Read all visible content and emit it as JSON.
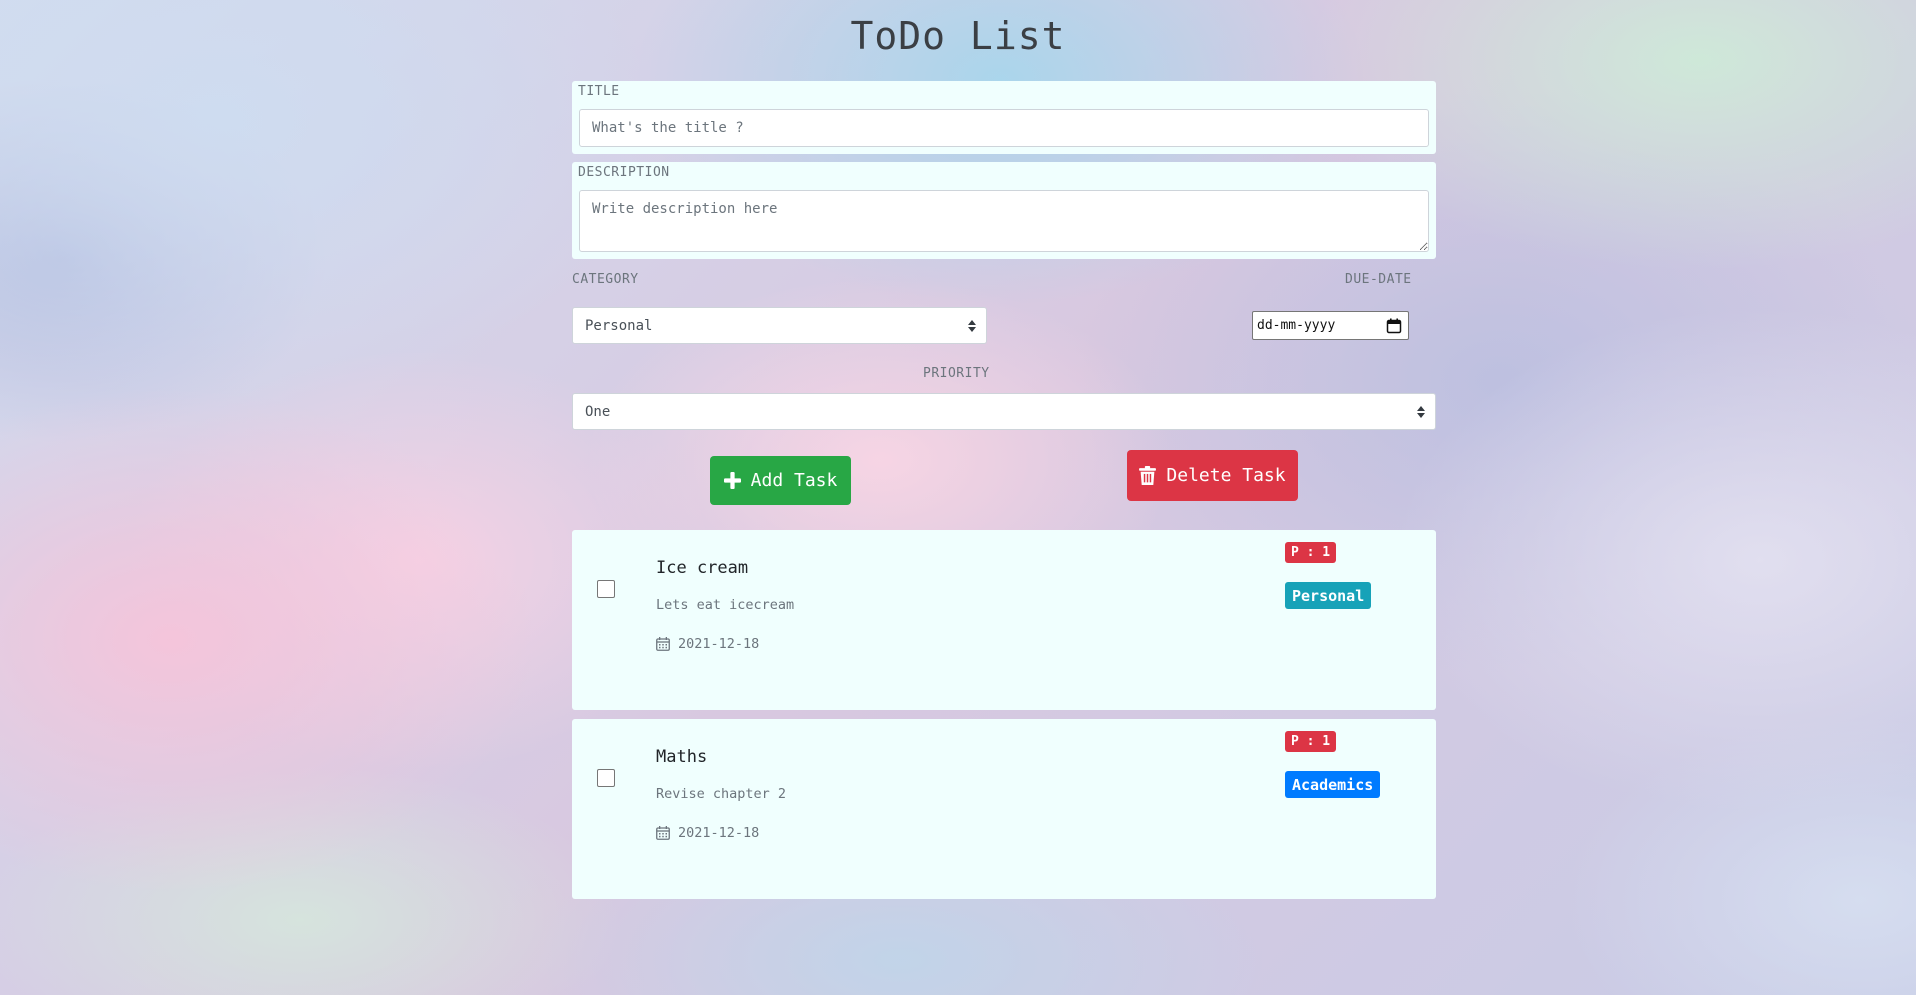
{
  "app": {
    "title": "ToDo List"
  },
  "form": {
    "title_label": "TITLE",
    "title_placeholder": "What's the title ?",
    "description_label": "DESCRIPTION",
    "description_placeholder": "Write description here",
    "category_label": "CATEGORY",
    "category_value": "Personal",
    "due_date_label": "DUE-DATE",
    "due_date_value": "dd-mm-yyyy",
    "priority_label": "PRIORITY",
    "priority_value": "One"
  },
  "actions": {
    "add_label": "Add Task",
    "delete_label": "Delete Task"
  },
  "tasks": [
    {
      "title": "Ice cream",
      "description": "Lets eat icecream",
      "due_date": "2021-12-18",
      "priority": "P : 1",
      "category": "Personal",
      "category_color": "#17a2b8",
      "checked": false
    },
    {
      "title": "Maths",
      "description": "Revise chapter 2",
      "due_date": "2021-12-18",
      "priority": "P : 1",
      "category": "Academics",
      "category_color": "#007bff",
      "checked": false
    }
  ],
  "colors": {
    "add_button": "#28a745",
    "delete_button": "#dc3545",
    "priority_badge": "#dc3545",
    "card_background": "#f0fffe"
  },
  "icons": {
    "add": "plus-icon",
    "delete": "trash-icon",
    "date": "calendar-icon",
    "select": "select-arrows-icon"
  }
}
